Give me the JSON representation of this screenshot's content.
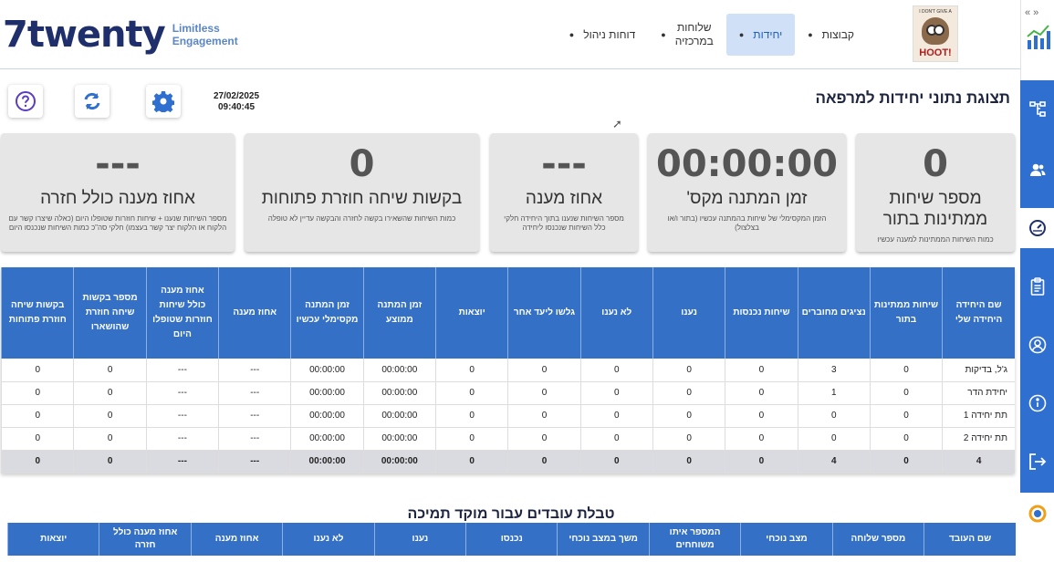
{
  "header": {
    "logo_word": "7twenty",
    "logo_tag_line1": "Limitless",
    "logo_tag_line2": "Engagement",
    "nav": [
      {
        "label": "קבוצות",
        "active": false
      },
      {
        "label": "יחידות",
        "active": true
      },
      {
        "label_line1": "שלוחות",
        "label_line2": "במרכזיה",
        "active": false
      },
      {
        "label": "דוחות ניהול",
        "active": false
      }
    ],
    "hoot_small_text": "I DON'T GIVE A",
    "hoot_brand": "HOOT!"
  },
  "sidebar": {
    "collapse_glyph": "« »",
    "icons": [
      "org-chart-icon",
      "users-icon",
      "gauge-icon",
      "clipboard-icon",
      "user-circle-icon",
      "info-icon",
      "logout-icon"
    ],
    "active_icon": "gauge-icon"
  },
  "page": {
    "title": "תצוגת נתוני יחידות למרפאה",
    "date": "27/02/2025",
    "time": "09:40:45"
  },
  "cards": [
    {
      "value": "0",
      "label": "מספר שיחות ממתינות בתור",
      "desc": "כמות השיחות הממתינות למענה עכשיו"
    },
    {
      "value": "00:00:00",
      "label": "זמן המתנה מקס'",
      "desc": "הזמן המקסימלי של שיחות בהמתנה עכשיו (בתור ו/או בצלצול)"
    },
    {
      "value": "---",
      "label": "אחוז מענה",
      "desc": "מספר השיחות שנענו בתוך היחידה חלקי כלל השיחות שנכנסו ליחידה"
    },
    {
      "value": "0",
      "label": "בקשות שיחה חוזרת פתוחות",
      "desc": "כמות השיחות שהשאירו בקשה לחזרה והבקשה עדיין לא טופלה"
    },
    {
      "value": "---",
      "label": "אחוז מענה כולל חזרה",
      "desc": "מספר השיחות שנענו + שיחות חוזרות שטופלו היום (כאלה שיצרו קשר עם הלקוח או הלקוח יצר קשר בעצמו) חלקי סה\"כ כמות השיחות שנכנסו היום"
    }
  ],
  "units_table": {
    "headers": [
      "שם היחידה היחידה שלי",
      "שיחות ממתינות בתור",
      "נציגים מחוברים",
      "שיחות נכנסות",
      "נענו",
      "לא נענו",
      "גלשו ליעד אחר",
      "יוצאות",
      "זמן המתנה ממוצע",
      "זמן המתנה מקסימלי עכשיו",
      "אחוז מענה",
      "אחוז מענה כולל שיחות חוזרות שטופלו היום",
      "מספר בקשות שיחה חוזרת שהושארו",
      "בקשות שיחה חוזרת פתוחות"
    ],
    "rows": [
      [
        "ג'ל, בדיקות",
        "0",
        "3",
        "0",
        "0",
        "0",
        "0",
        "0",
        "00:00:00",
        "00:00:00",
        "---",
        "---",
        "0",
        "0"
      ],
      [
        "יחידת הדר",
        "0",
        "1",
        "0",
        "0",
        "0",
        "0",
        "0",
        "00:00:00",
        "00:00:00",
        "---",
        "---",
        "0",
        "0"
      ],
      [
        "תת יחידה 1",
        "0",
        "0",
        "0",
        "0",
        "0",
        "0",
        "0",
        "00:00:00",
        "00:00:00",
        "---",
        "---",
        "0",
        "0"
      ],
      [
        "תת יחידה 2",
        "0",
        "0",
        "0",
        "0",
        "0",
        "0",
        "0",
        "00:00:00",
        "00:00:00",
        "---",
        "---",
        "0",
        "0"
      ]
    ],
    "total": [
      "4",
      "0",
      "4",
      "0",
      "0",
      "0",
      "0",
      "0",
      "00:00:00",
      "00:00:00",
      "---",
      "---",
      "0",
      "0"
    ]
  },
  "employees": {
    "title": "טבלת עובדים עבור מוקד תמיכה",
    "headers": [
      "שם העובד",
      "מספר שלוחה",
      "מצב נוכחי",
      "המספר איתו משוחחים",
      "משך במצב נוכחי",
      "נכנסו",
      "נענו",
      "לא נענו",
      "אחוז מענה",
      "אחוז מענה כולל חזרה",
      "יוצאות"
    ]
  },
  "colors": {
    "brand_navy": "#1f2f6b",
    "accent_blue": "#3570c7",
    "sidebar_blue": "#2f6fd0",
    "card_bg": "#e6e6e6"
  }
}
